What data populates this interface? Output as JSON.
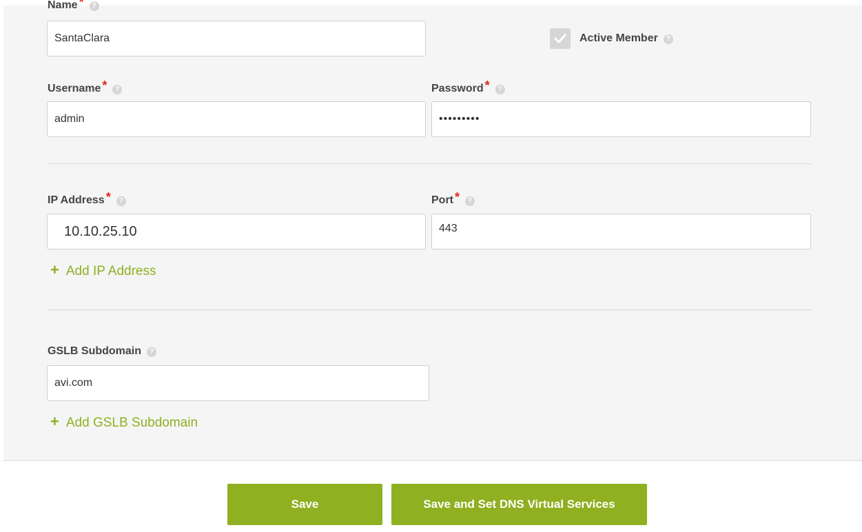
{
  "form": {
    "name": {
      "label": "Name",
      "value": "SantaClara"
    },
    "active_member": {
      "label": "Active Member",
      "checked": true
    },
    "username": {
      "label": "Username",
      "value": "admin"
    },
    "password": {
      "label": "Password",
      "value": "•••••••••"
    },
    "ip_address": {
      "label": "IP Address",
      "value": "10.10.25.10"
    },
    "port": {
      "label": "Port",
      "value": "443"
    },
    "add_ip_label": "Add IP Address",
    "gslb_subdomain": {
      "label": "GSLB Subdomain",
      "value": "avi.com"
    },
    "add_subdomain_label": "Add GSLB Subdomain",
    "required_mark": "*",
    "help_glyph": "?",
    "plus_glyph": "+"
  },
  "footer": {
    "save_label": "Save",
    "save_set_dns_label": "Save and Set DNS Virtual Services"
  },
  "colors": {
    "accent": "#8eb021",
    "required": "#e8231c"
  },
  "icons": [
    "help-icon",
    "check-icon",
    "plus-icon"
  ]
}
